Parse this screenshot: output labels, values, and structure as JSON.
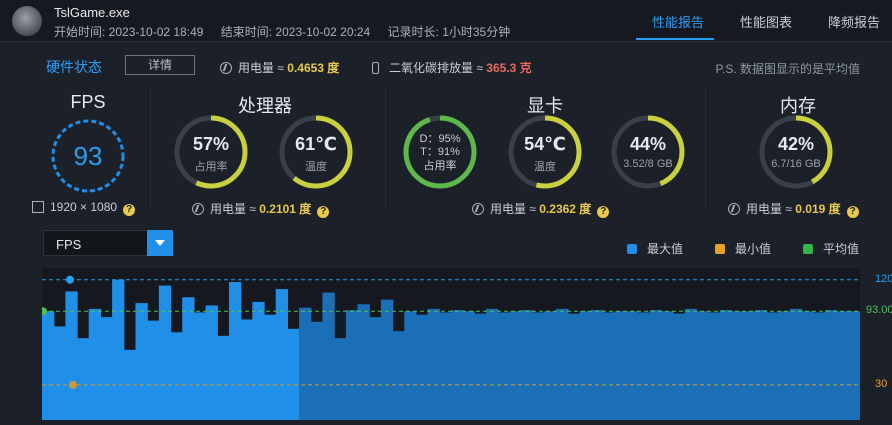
{
  "header": {
    "app_name": "TslGame.exe",
    "start_label": "开始时间: 2023-10-02 18:49",
    "end_label": "结束时间: 2023-10-02 20:24",
    "duration_label": "记录时长: 1小时35分钟",
    "tabs": [
      {
        "label": "性能报告",
        "active": true
      },
      {
        "label": "性能图表",
        "active": false
      },
      {
        "label": "降频报告",
        "active": false
      }
    ]
  },
  "status_row": {
    "title": "硬件状态",
    "detail_button": "详情",
    "power_label": "用电量 ≈",
    "power_value": "0.4653 度",
    "co2_label": "二氧化碳排放量 ≈",
    "co2_value": "365.3 克",
    "ps_note": "P.S. 数据图显示的是平均值"
  },
  "sections": {
    "fps": {
      "title": "FPS",
      "value": "93",
      "resolution": "1920 × 1080"
    },
    "cpu": {
      "title": "处理器",
      "usage": {
        "value": "57%",
        "label": "占用率",
        "level": 0.57
      },
      "temp": {
        "value": "61℃",
        "label": "温度",
        "level": 0.61
      },
      "power_label": "用电量 ≈",
      "power_value": "0.2101 度"
    },
    "gpu": {
      "title": "显卡",
      "usage": {
        "d_line": "D：95%",
        "t_line": "T：91%",
        "label": "占用率",
        "level": 0.95
      },
      "temp": {
        "value": "54℃",
        "label": "温度",
        "level": 0.54
      },
      "vram": {
        "value": "44%",
        "label": "3.52/8 GB",
        "level": 0.44
      },
      "power_label": "用电量 ≈",
      "power_value": "0.2362 度"
    },
    "mem": {
      "title": "内存",
      "usage": {
        "value": "42%",
        "label": "6.7/16 GB",
        "level": 0.42
      },
      "power_label": "用电量 ≈",
      "power_value": "0.019 度"
    }
  },
  "chart_controls": {
    "selected_metric": "FPS",
    "legend": [
      {
        "label": "最大值",
        "color": "#1f8fe8"
      },
      {
        "label": "最小值",
        "color": "#e8a02a"
      },
      {
        "label": "平均值",
        "color": "#35b44a"
      }
    ]
  },
  "colors": {
    "accent": "#2a9df4",
    "gauge_track": "#3a4049",
    "gauge_fill_yellow": "#c9cf3e",
    "gauge_fill_green": "#5fb84a",
    "fps_bars": "#1f8fe8"
  },
  "chart_data": {
    "type": "area",
    "series": [
      {
        "name": "FPS",
        "values": [
          93,
          80,
          110,
          70,
          95,
          88,
          120,
          60,
          100,
          85,
          115,
          75,
          105,
          92,
          98,
          72,
          118,
          86,
          101,
          90,
          112,
          78,
          96,
          84,
          109,
          70,
          94,
          99,
          88,
          103,
          76,
          93,
          90,
          95,
          92,
          94,
          93,
          91,
          95,
          92,
          93,
          94,
          92,
          93,
          95,
          91,
          93,
          94,
          92,
          93,
          93,
          92,
          94,
          93,
          91,
          95,
          93,
          92,
          94,
          93,
          93,
          94,
          92,
          93,
          95,
          93,
          92,
          94,
          93,
          93
        ]
      }
    ],
    "max_line": 120,
    "min_line": 30,
    "avg_line": 93.0,
    "tick_labels": [
      "120",
      "93.00",
      "30"
    ],
    "ylim": [
      0,
      130
    ]
  }
}
